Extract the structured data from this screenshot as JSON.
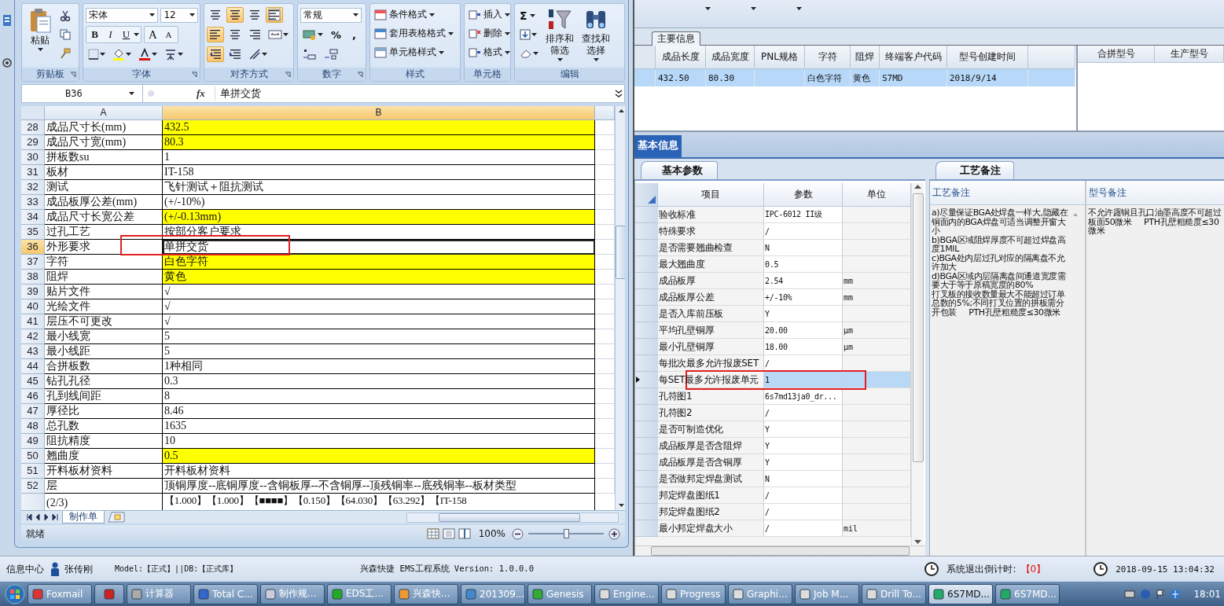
{
  "excel": {
    "ribbon": {
      "clipboard": {
        "paste": "粘贴",
        "label": "剪贴板"
      },
      "font": {
        "name": "宋体",
        "size": "12",
        "bold": "B",
        "italic": "I",
        "underline": "U",
        "grow": "A",
        "shrink": "A",
        "label": "字体"
      },
      "alignment": {
        "label": "对齐方式"
      },
      "number": {
        "format": "常规",
        "percent": "%",
        "comma": ",",
        "label": "数字"
      },
      "styles": {
        "items": [
          "条件格式",
          "套用表格格式",
          "单元格样式"
        ],
        "label": "样式"
      },
      "cells": {
        "items": [
          "插入",
          "删除",
          "格式"
        ],
        "label": "单元格"
      },
      "editing": {
        "sum": "Σ",
        "sort": [
          "排序和",
          "筛选"
        ],
        "find": [
          "查找和",
          "选择"
        ],
        "label": "编辑"
      }
    },
    "name_box": "B36",
    "formula_icon": "fx",
    "formula": "单拼交货",
    "columns": [
      {
        "label": "A",
        "selected": false
      },
      {
        "label": "B",
        "selected": true
      }
    ],
    "rows": [
      {
        "number": "28",
        "a": "成品尺寸长(mm)",
        "b": "432.5",
        "highlighted": true,
        "selected": false
      },
      {
        "number": "29",
        "a": "成品尺寸宽(mm)",
        "b": "80.3",
        "highlighted": true,
        "selected": false
      },
      {
        "number": "30",
        "a": "拼板数su",
        "b": "1",
        "highlighted": false,
        "selected": false
      },
      {
        "number": "31",
        "a": "板材",
        "b": "IT-158",
        "highlighted": false,
        "selected": false
      },
      {
        "number": "32",
        "a": "测试",
        "b": "飞针测试＋阻抗测试",
        "highlighted": false,
        "selected": false
      },
      {
        "number": "33",
        "a": "成品板厚公差(mm)",
        "b": "(+/-10%)",
        "highlighted": false,
        "selected": false
      },
      {
        "number": "34",
        "a": "成品尺寸长宽公差",
        "b": "(+/-0.13mm)",
        "highlighted": true,
        "selected": false
      },
      {
        "number": "35",
        "a": "过孔工艺",
        "b": "按部分客户要求",
        "highlighted": false,
        "selected": false
      },
      {
        "number": "36",
        "a": "外形要求",
        "b": "单拼交货",
        "highlighted": false,
        "selected": true
      },
      {
        "number": "37",
        "a": "字符",
        "b": "白色字符",
        "highlighted": true,
        "selected": false
      },
      {
        "number": "38",
        "a": "阻焊",
        "b": "黄色",
        "highlighted": true,
        "selected": false
      },
      {
        "number": "39",
        "a": "贴片文件",
        "b": "√",
        "highlighted": false,
        "selected": false
      },
      {
        "number": "40",
        "a": "光绘文件",
        "b": "√",
        "highlighted": false,
        "selected": false
      },
      {
        "number": "41",
        "a": "层压不可更改",
        "b": "√",
        "highlighted": false,
        "selected": false
      },
      {
        "number": "42",
        "a": "最小线宽",
        "b": "5",
        "highlighted": false,
        "selected": false
      },
      {
        "number": "43",
        "a": "最小线距",
        "b": "5",
        "highlighted": false,
        "selected": false
      },
      {
        "number": "44",
        "a": "合拼板数",
        "b": "1种相同",
        "highlighted": false,
        "selected": false
      },
      {
        "number": "45",
        "a": "钻孔孔径",
        "b": "0.3",
        "highlighted": false,
        "selected": false
      },
      {
        "number": "46",
        "a": "孔到线间距",
        "b": "8",
        "highlighted": false,
        "selected": false
      },
      {
        "number": "47",
        "a": "厚径比",
        "b": "8.46",
        "highlighted": false,
        "selected": false
      },
      {
        "number": "48",
        "a": "总孔数",
        "b": "1635",
        "highlighted": false,
        "selected": false
      },
      {
        "number": "49",
        "a": "阻抗精度",
        "b": "10",
        "highlighted": false,
        "selected": false
      },
      {
        "number": "50",
        "a": "翘曲度",
        "b": "0.5",
        "highlighted": true,
        "selected": false
      },
      {
        "number": "51",
        "a": "开料板材资料",
        "b": "开料板材资料",
        "highlighted": false,
        "selected": false
      },
      {
        "number": "52",
        "a": "层",
        "b": "顶铜厚度--底铜厚度--含铜板厚--不含铜厚--顶残铜率--底残铜率--板材类型",
        "highlighted": false,
        "selected": false
      },
      {
        "a": "(2/3)",
        "b": "【1.000】【1.000】【■■■■】【0.150】【64.030】【63.292】【IT-158",
        "highlighted": false,
        "selected": false
      }
    ],
    "sheet_tabs": [
      {
        "label": "制作单",
        "selected": true
      }
    ],
    "status": "就绪",
    "zoom": "100%",
    "zoom_slider": {
      "level": 0.5
    }
  },
  "main_info": {
    "tab": "主要信息",
    "columns": [
      "成品长度",
      "成品宽度",
      "PNL规格",
      "字符",
      "阻焊",
      "终端客户代码",
      "型号创建时间"
    ],
    "rows": [
      {
        "cells": [
          "432.50",
          "80.30",
          null,
          "白色字符",
          "黄色",
          "S7MD",
          "2018/9/14"
        ],
        "selected": true
      }
    ],
    "side_columns": [
      "合拼型号",
      "生产型号"
    ]
  },
  "info_tabs": [
    {
      "label": "基本信息",
      "selected": true
    }
  ],
  "params_panel": {
    "tab": "基本参数",
    "columns": [
      "项目",
      "参数",
      "单位"
    ],
    "rows": [
      {
        "item": "验收标准",
        "value": "IPC-6012 II级",
        "selected": false
      },
      {
        "item": "特殊要求",
        "value": "/",
        "selected": false
      },
      {
        "item": "是否需要翘曲检查",
        "value": "N",
        "selected": false
      },
      {
        "item": "最大翘曲度",
        "value": "0.5",
        "selected": false
      },
      {
        "item": "成品板厚",
        "value": "2.54",
        "unit": "mm",
        "selected": false
      },
      {
        "item": "成品板厚公差",
        "value": "+/-10%",
        "unit": "mm",
        "selected": false
      },
      {
        "item": "是否入库前压板",
        "value": "Y",
        "selected": false
      },
      {
        "item": "平均孔壁铜厚",
        "value": "20.00",
        "unit": "μm",
        "selected": false
      },
      {
        "item": "最小孔壁铜厚",
        "value": "18.00",
        "unit": "μm",
        "selected": false
      },
      {
        "item": "每批次最多允许报废SET",
        "value": "/",
        "selected": false
      },
      {
        "item": "每SET最多允许报废单元",
        "value": "1",
        "selected": true
      },
      {
        "item": "孔符图1",
        "value": "6s7md13ja0_dr...",
        "selected": false
      },
      {
        "item": "孔符图2",
        "value": "/",
        "selected": false
      },
      {
        "item": "是否可制造优化",
        "value": "Y",
        "selected": false
      },
      {
        "item": "成品板厚是否含阻焊",
        "value": "Y",
        "selected": false
      },
      {
        "item": "成品板厚是否含铜厚",
        "value": "Y",
        "selected": false
      },
      {
        "item": "是否做邦定焊盘测试",
        "value": "N",
        "selected": false
      },
      {
        "item": "邦定焊盘图纸1",
        "value": "/",
        "selected": false
      },
      {
        "item": "邦定焊盘图纸2",
        "value": "/",
        "selected": false
      },
      {
        "item": "最小邦定焊盘大小",
        "value": "/",
        "unit": "mil",
        "selected": false
      }
    ]
  },
  "remarks_panel": {
    "tab": "工艺备注",
    "columns": [
      "工艺备注",
      "型号备注"
    ],
    "process_note": "a)尽量保证BGA处焊盘一样大,隐藏在铜面内的BGA焊盘可适当调整开窗大小\nb)BGA区域阻焊厚度不可超过焊盘高度1MIL\nc)BGA处内层过孔对应的隔离盘不允许加大\nd)BGA区域内层隔离盘间通道宽度需要大于等于原稿宽度的80%\n打叉板的接收数量最大不能超过订单总数的5%;不同打叉位置的拼板需分开包装     PTH孔壁粗糙度≤30微米",
    "model_note": "不允许露铜且孔口油墨高度不可超过板面50微米     PTH孔壁粗糙度≤30微米"
  },
  "status_bar": {
    "info_center": "信息中心",
    "user": "张传刚",
    "model": "Model:【正式】||DB:【正式库】",
    "system": "兴森快捷 EMS工程系统 Version: 1.0.0.0",
    "countdown_label": "系统退出倒计时:",
    "countdown": "【0】",
    "datetime": "2018-09-15 13:04:32"
  },
  "taskbar": {
    "items": [
      {
        "kind": "app",
        "label": "Foxmail",
        "selected": false
      },
      {
        "kind": "icon",
        "selected": false
      },
      {
        "kind": "app",
        "label": "计算器",
        "selected": false
      },
      {
        "kind": "app",
        "label": "Total C...",
        "selected": false
      },
      {
        "kind": "app",
        "label": "制作规...",
        "selected": false
      },
      {
        "kind": "app",
        "label": "EDS工...",
        "selected": false
      },
      {
        "kind": "app",
        "label": "兴森快...",
        "selected": false
      },
      {
        "kind": "app",
        "label": "201309...",
        "selected": false
      },
      {
        "kind": "app",
        "label": "Genesis",
        "selected": false
      },
      {
        "kind": "app",
        "label": "Engine...",
        "selected": false
      },
      {
        "kind": "app",
        "label": "Progress",
        "selected": false
      },
      {
        "kind": "app",
        "label": "Graphi...",
        "selected": false
      },
      {
        "kind": "app",
        "label": "Job M...",
        "selected": false
      },
      {
        "kind": "app",
        "label": "Drill To...",
        "selected": false
      },
      {
        "kind": "app",
        "label": "6S7MD...",
        "selected": true
      },
      {
        "kind": "app",
        "label": "6S7MD...",
        "selected": false
      }
    ],
    "clock": "18:01"
  }
}
